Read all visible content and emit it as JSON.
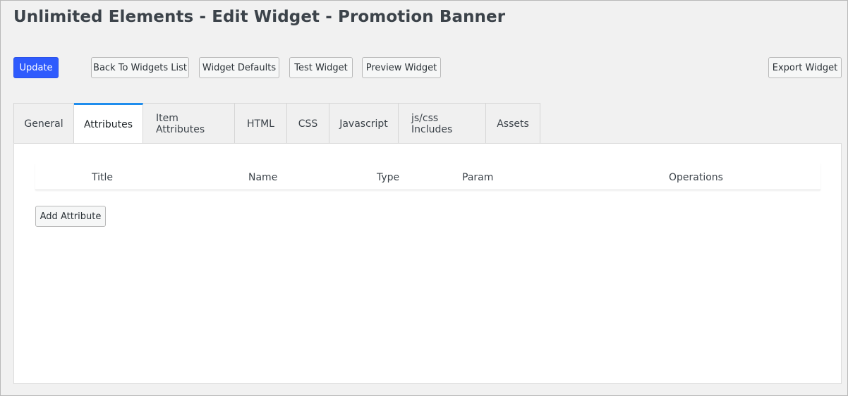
{
  "page": {
    "title": "Unlimited Elements - Edit Widget - Promotion Banner"
  },
  "toolbar": {
    "update_label": "Update",
    "back_label": "Back To Widgets List",
    "defaults_label": "Widget Defaults",
    "test_label": "Test Widget",
    "preview_label": "Preview Widget",
    "export_label": "Export Widget"
  },
  "tabs": [
    {
      "label": "General",
      "active": false
    },
    {
      "label": "Attributes",
      "active": true
    },
    {
      "label": "Item Attributes",
      "active": false
    },
    {
      "label": "HTML",
      "active": false
    },
    {
      "label": "CSS",
      "active": false
    },
    {
      "label": "Javascript",
      "active": false
    },
    {
      "label": "js/css Includes",
      "active": false
    },
    {
      "label": "Assets",
      "active": false
    }
  ],
  "attributes_table": {
    "columns": [
      "Title",
      "Name",
      "Type",
      "Param",
      "Operations"
    ],
    "rows": []
  },
  "add_attribute_label": "Add Attribute",
  "colors": {
    "primary": "#2f5bfd",
    "active_tab_accent": "#1f8ded",
    "background": "#f1f1f1"
  }
}
